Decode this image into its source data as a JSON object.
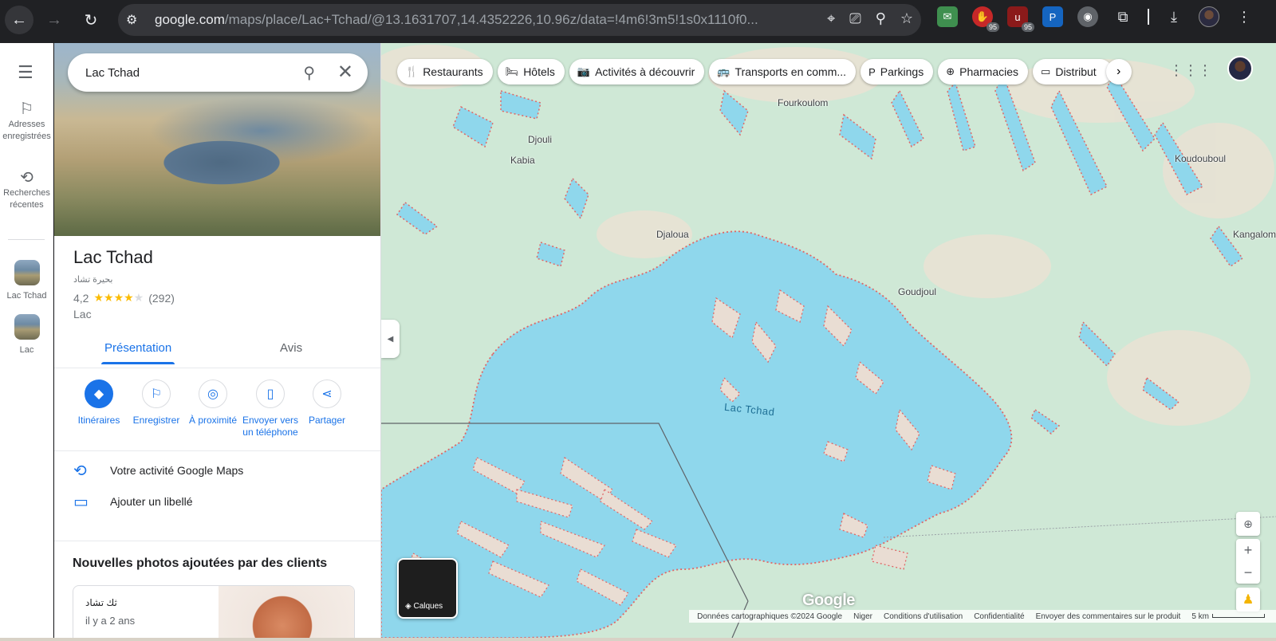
{
  "browser": {
    "url_host": "google.com",
    "url_path": "/maps/place/Lac+Tchad/@13.1631707,14.4352226,10.96z/data=!4m6!3m5!1s0x1110f0...",
    "ext_badge_1": "95",
    "ext_badge_2": "95"
  },
  "rail": {
    "saved_label": "Adresses enregistrées",
    "recent_label": "Recherches récentes",
    "recent_place_1": "Lac Tchad",
    "recent_place_2": "Lac"
  },
  "search": {
    "query": "Lac Tchad"
  },
  "place": {
    "name": "Lac Tchad",
    "alt_name": "بحيرة تشاد",
    "rating": "4,2",
    "rating_value": 4.2,
    "review_count": "(292)",
    "category": "Lac"
  },
  "tabs": {
    "overview": "Présentation",
    "reviews": "Avis"
  },
  "actions": {
    "directions": "Itinéraires",
    "save": "Enregistrer",
    "nearby": "À proximité",
    "send_line1": "Envoyer vers",
    "send_line2": "un téléphone",
    "share": "Partager"
  },
  "list": {
    "activity": "Votre activité Google Maps",
    "label": "Ajouter un libellé"
  },
  "photos": {
    "section_title": "Nouvelles photos ajoutées par des clients",
    "author": "ثك تشاد",
    "time": "il y a 2 ans"
  },
  "chips": {
    "restaurants": "Restaurants",
    "hotels": "Hôtels",
    "activities": "Activités à découvrir",
    "transit": "Transports en comm...",
    "parking": "Parkings",
    "pharmacies": "Pharmacies",
    "atm": "Distribut"
  },
  "map": {
    "lake_label": "Lac Tchad",
    "places": {
      "fourkoulom": "Fourkoulom",
      "djouli": "Djouli",
      "kabia": "Kabia",
      "koudouboul": "Koudouboul",
      "djaloua": "Djaloua",
      "kangalom": "Kangalom",
      "goudjoul": "Goudjoul"
    },
    "layers_label": "Calques",
    "logo": "Google",
    "water_color": "#8fd7ec",
    "land_color": "#cfe8d6"
  },
  "footer": {
    "data": "Données cartographiques ©2024 Google",
    "country": "Niger",
    "terms": "Conditions d'utilisation",
    "privacy": "Confidentialité",
    "feedback": "Envoyer des commentaires sur le produit",
    "scale": "5 km"
  }
}
